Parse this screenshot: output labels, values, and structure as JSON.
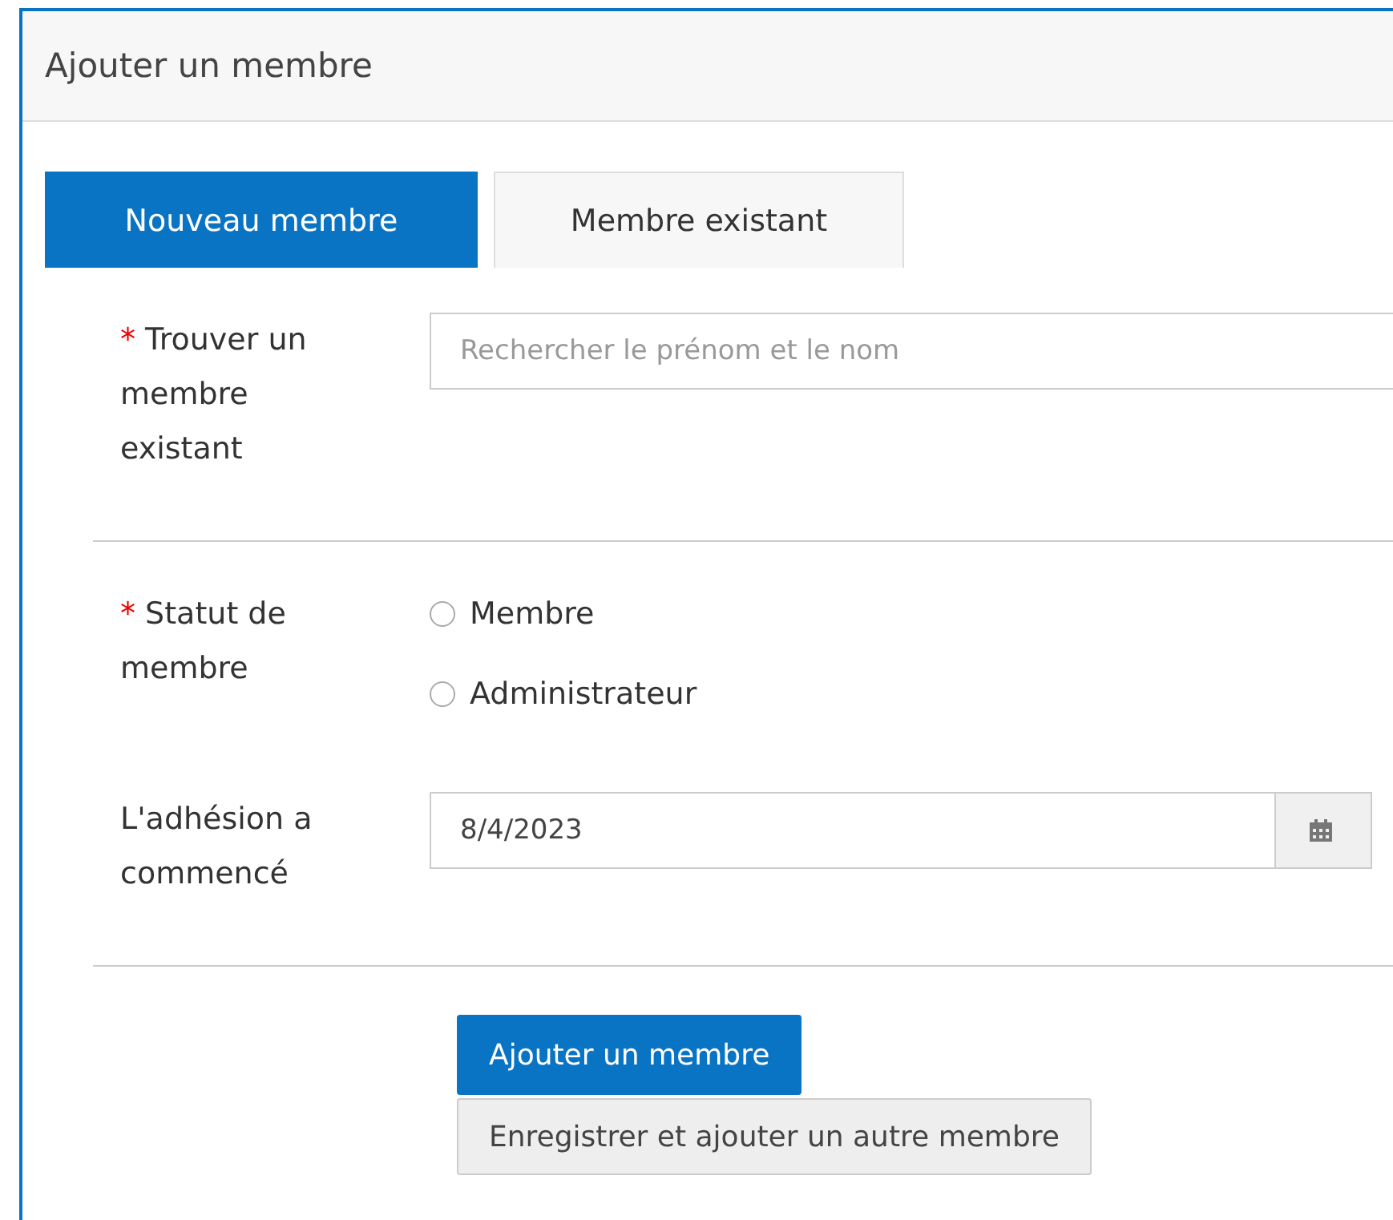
{
  "panel": {
    "title": "Ajouter un membre"
  },
  "tabs": [
    {
      "label": "Nouveau membre",
      "selected": true
    },
    {
      "label": "Membre existant",
      "selected": false
    }
  ],
  "sections": [
    {
      "fields": [
        {
          "kind": "search",
          "label": "Trouver un membre existant",
          "marker": "*",
          "placeholder": "Rechercher le prénom et le nom"
        }
      ]
    },
    {
      "fields": [
        {
          "kind": "radio",
          "label": "Statut de membre",
          "marker": "*",
          "options": [
            {
              "label": "Membre",
              "selected": false
            },
            {
              "label": "Administrateur",
              "selected": false
            }
          ]
        },
        {
          "kind": "date",
          "label": "L'adhésion a commencé",
          "value": "8/4/2023"
        }
      ]
    }
  ],
  "buttons": [
    {
      "kind": "primary",
      "label": "Ajouter un membre"
    },
    {
      "kind": "secondary",
      "label": "Enregistrer et ajouter un autre membre"
    }
  ]
}
